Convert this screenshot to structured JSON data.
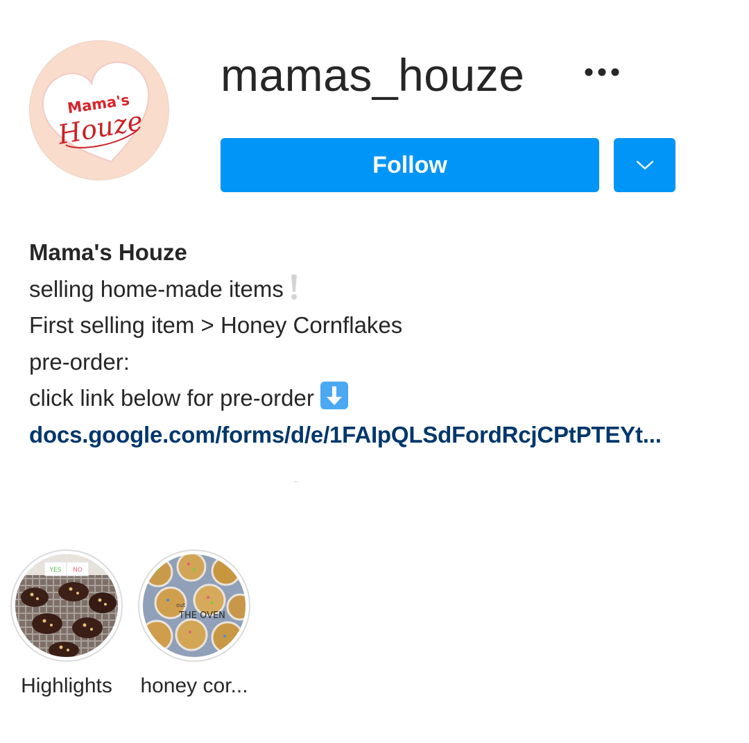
{
  "profile": {
    "username": "mamas_houze",
    "avatar_text_top": "Mama's",
    "avatar_text_bottom": "Houze"
  },
  "actions": {
    "follow_label": "Follow",
    "more_icon": "more-horizontal-icon",
    "dropdown_icon": "chevron-down-icon"
  },
  "bio": {
    "display_name": "Mama's Houze",
    "lines": [
      "selling home-made items",
      "First selling item > Honey Cornflakes",
      "pre-order:",
      "click link below for pre-order"
    ],
    "line1_emoji": "exclamation-emoji",
    "line4_emoji": "down-arrow-emoji",
    "link": "docs.google.com/forms/d/e/1FAIpQLSdFordRcjCPtPTEYt..."
  },
  "highlights": [
    {
      "label": "Highlights",
      "poll_yes": "YES",
      "poll_no": "NO"
    },
    {
      "label": "honey cor...",
      "overlay_text_small": "out",
      "overlay_text": "THE OVEN"
    }
  ],
  "colors": {
    "follow_button": "#0095f6",
    "link": "#00376b",
    "text": "#262626",
    "avatar_bg": "#f9dccb",
    "brand_red": "#d8232a"
  }
}
